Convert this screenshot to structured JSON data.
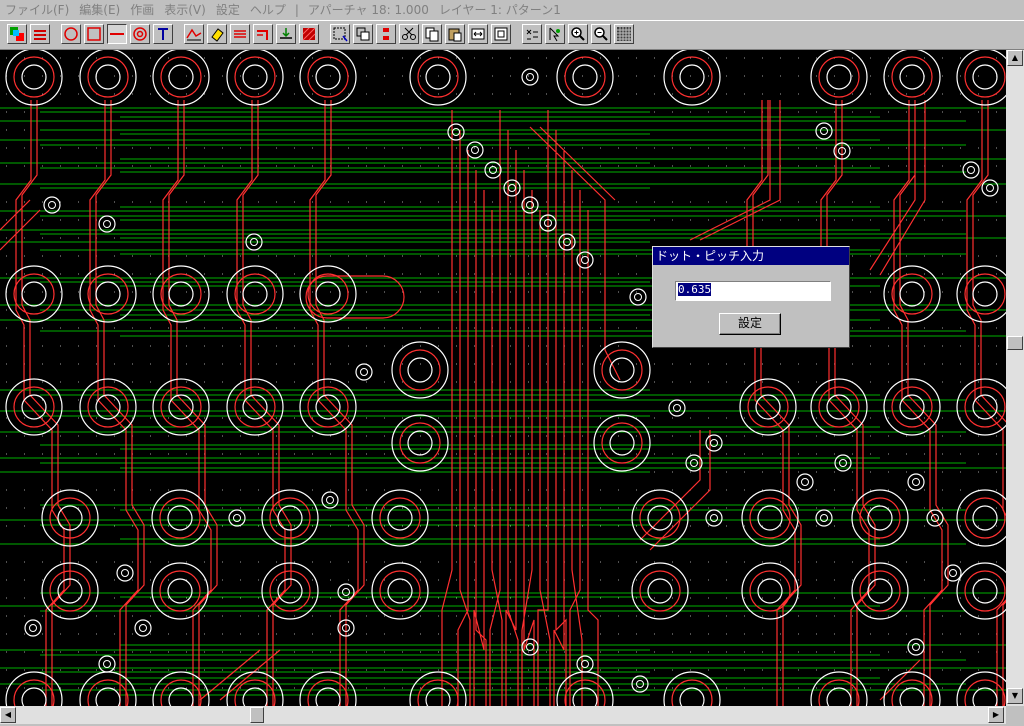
{
  "menubar": {
    "items": [
      "ファイル(F)",
      "編集(E)",
      "作画",
      "表示(V)",
      "設定",
      "ヘルプ"
    ],
    "separator": "|",
    "aperture_status": "アパーチャ 18: 1.000",
    "layer_status": "レイヤー 1: パターン1"
  },
  "toolbar": {
    "buttons": [
      "layer-color-icon",
      "layer-stack-icon",
      "circle-tool-icon",
      "rect-tool-icon",
      "line-tool-icon",
      "pad-tool-icon",
      "text-tool-icon",
      "trace-tool-icon",
      "eraser-icon",
      "bus-tool-icon",
      "bend-tool-icon",
      "move-point-icon",
      "fill-tool-icon",
      "select-rect-icon",
      "copy-area-icon",
      "align-icon",
      "cut-icon",
      "copy-icon",
      "paste-icon",
      "mirror-icon",
      "frame-icon",
      "measure-icon",
      "cursor-icon",
      "zoom-in-icon",
      "zoom-out-icon",
      "grid-icon"
    ]
  },
  "dialog": {
    "title": "ドット・ピッチ入力",
    "input_value": "0.635",
    "button_label": "設定"
  },
  "colors": {
    "trace": "#ff3030",
    "pad": "#ffffff",
    "ground_line": "#00b000",
    "background": "#000000",
    "titlebar": "#000080"
  }
}
